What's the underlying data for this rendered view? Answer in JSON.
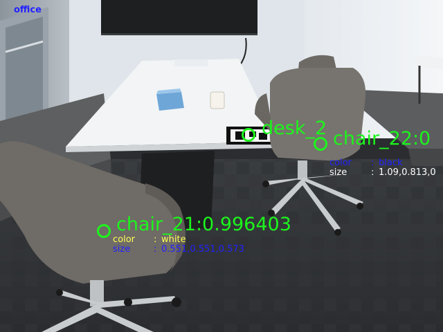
{
  "scene_label": "office",
  "detections": [
    {
      "label": "desk_2",
      "attributes": []
    },
    {
      "label": "chair_22:0",
      "attributes": [
        {
          "key": "color",
          "sep": ": ",
          "value": "black"
        },
        {
          "key": "size",
          "sep": ": ",
          "value": "1.09,0.813,0"
        }
      ]
    },
    {
      "label": "chair_21:0.996403",
      "attributes": [
        {
          "key": "color",
          "sep": ": ",
          "value": "white"
        },
        {
          "key": "size",
          "sep": ": ",
          "value": "0.551,0.551,0.573"
        }
      ]
    }
  ],
  "colors": {
    "detection_label": "#1cf51c",
    "marker": "#1cf51c",
    "scene_label": "#2222ff",
    "chair_22_key": "#2222ff",
    "chair_22_color_value": "#2222ff",
    "chair_22_size_value": "#ffffff",
    "chair_21_key": "#ffff55",
    "chair_21_color_value": "#ffff55",
    "chair_21_size_value": "#2222ff"
  }
}
